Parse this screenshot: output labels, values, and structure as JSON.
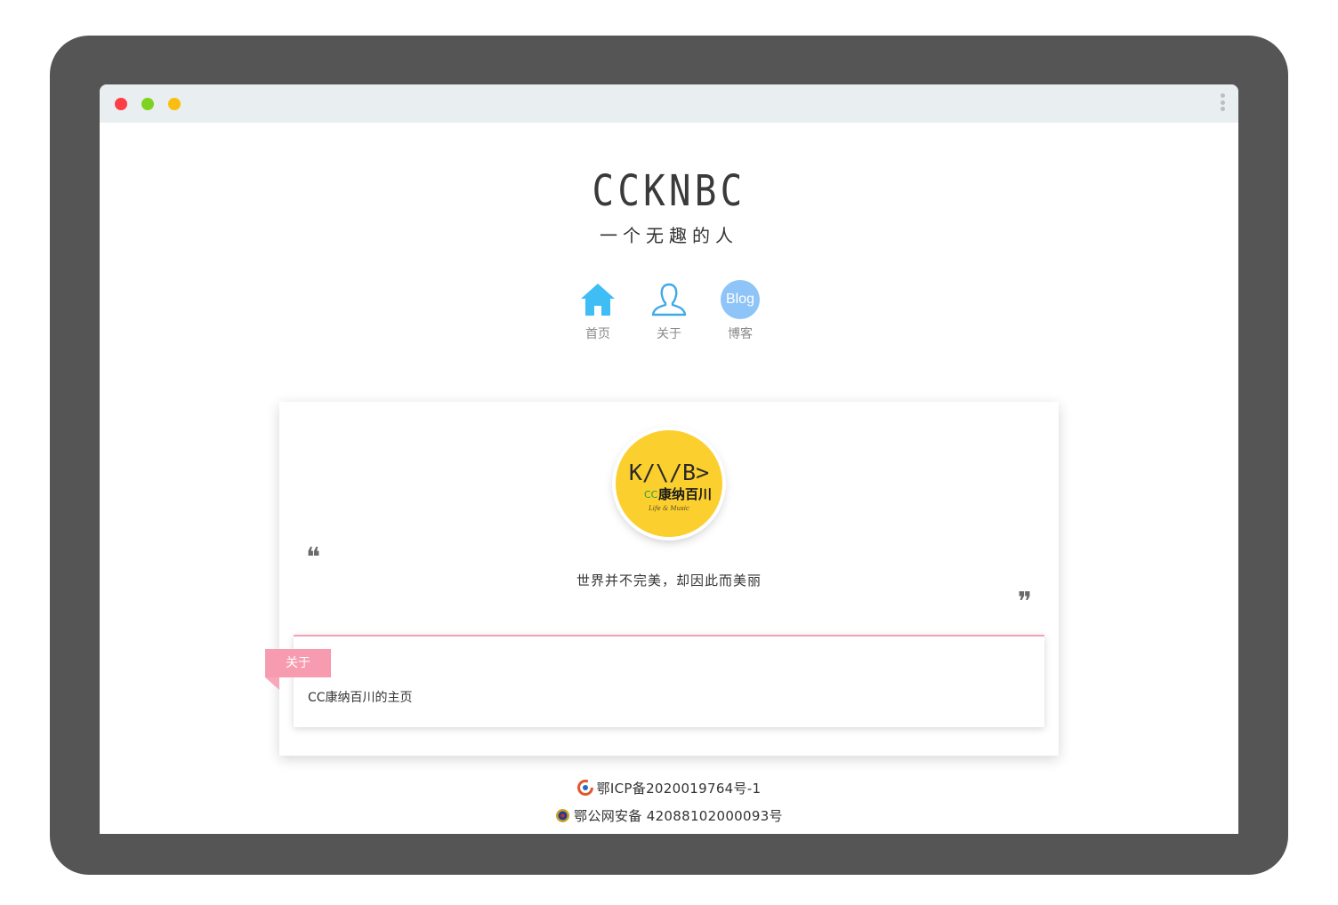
{
  "window": {
    "controls": [
      "close",
      "minimize",
      "maximize"
    ],
    "menu_icon": "kebab-icon"
  },
  "site": {
    "title": "CCKNBC",
    "subtitle": "一个无趣的人"
  },
  "nav": [
    {
      "label": "首页",
      "icon": "home-icon",
      "color": "#3fbdf5"
    },
    {
      "label": "关于",
      "icon": "user-icon",
      "color": "#3fa9e8"
    },
    {
      "label": "博客",
      "icon": "blog-icon",
      "icon_text": "Blog",
      "color": "#8ec4f7"
    }
  ],
  "profile": {
    "logo_text": "K/\\/B>",
    "logo_cn": "康纳百川",
    "logo_cc": "CC",
    "logo_sub": "Life & Music",
    "logo_bg": "#fbcf2e",
    "motto": "世界并不完美，却因此而美丽"
  },
  "about": {
    "tag": "关于",
    "text": "CC康纳百川的主页",
    "accent": "#f79cb0"
  },
  "footer": {
    "icp": "鄂ICP备2020019764号-1",
    "police": "鄂公网安备 42088102000093号"
  }
}
